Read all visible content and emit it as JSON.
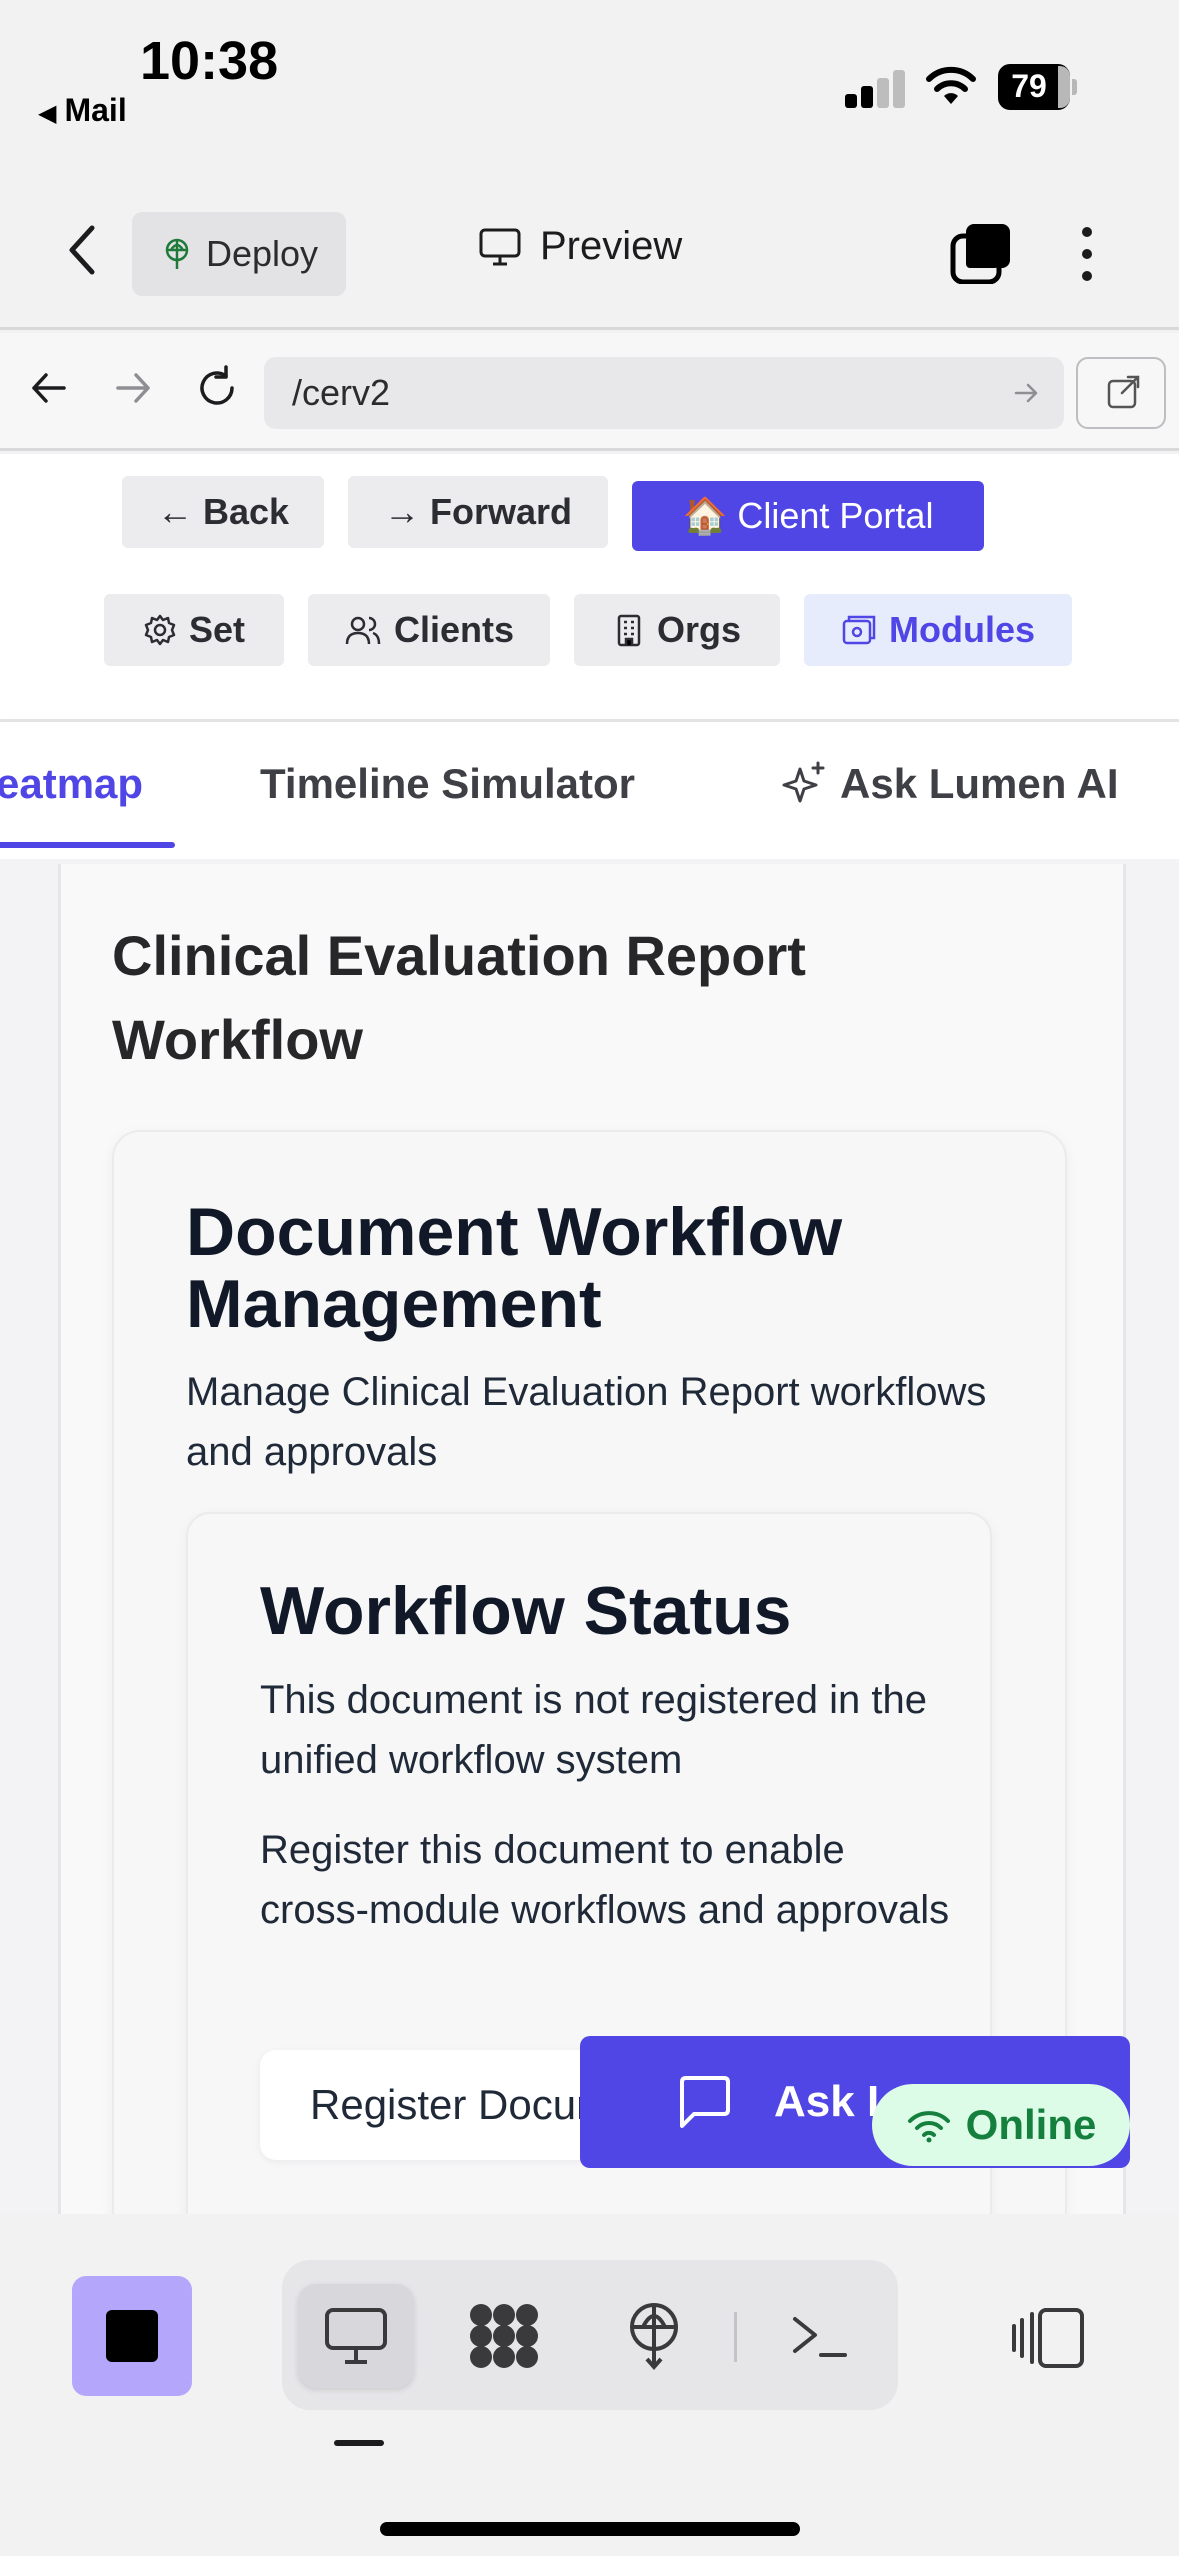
{
  "status_bar": {
    "time": "10:38",
    "back_app": "Mail",
    "battery": "79"
  },
  "header": {
    "deploy_label": "Deploy",
    "preview_label": "Preview"
  },
  "browser": {
    "url": "/cerv2"
  },
  "nav_buttons": {
    "back": "← Back",
    "forward": "→ Forward",
    "client_portal": "🏠 Client Portal"
  },
  "module_tabs": [
    {
      "label": "Set",
      "icon": "gear-icon"
    },
    {
      "label": "Clients",
      "icon": "users-icon"
    },
    {
      "label": "Orgs",
      "icon": "building-icon"
    },
    {
      "label": "Modules",
      "icon": "modules-icon",
      "active": true
    }
  ],
  "sub_tabs": [
    {
      "label": "eatmap",
      "active": true
    },
    {
      "label": "Timeline Simulator"
    },
    {
      "label": "Ask Lumen AI",
      "icon": "sparkles-icon"
    }
  ],
  "main": {
    "section_title": "Clinical Evaluation Report Workflow",
    "card_title": "Document Workflow Management",
    "card_subtitle": "Manage Clinical Evaluation Report workflows and approvals",
    "status_title": "Workflow Status",
    "status_text_1": "This document is not registered in the unified workflow system",
    "status_text_2": "Register this document to enable cross-module workflows and approvals",
    "register_button": "Register Document"
  },
  "floating": {
    "ask_label": "Ask Lumen AI",
    "online_label": "Online"
  },
  "colors": {
    "accent": "#4f46e5",
    "stop_button": "#b4a7fb",
    "online_bg": "#dcfce7",
    "online_text": "#15803d"
  }
}
